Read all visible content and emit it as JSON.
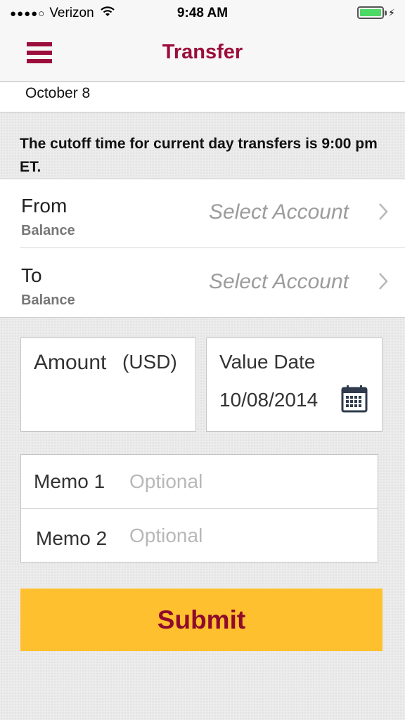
{
  "status_bar": {
    "signal_dots": "●●●●○",
    "carrier": "Verizon",
    "time": "9:48 AM",
    "battery_level": 1.0,
    "battery_color": "#4cd964"
  },
  "nav": {
    "title": "Transfer",
    "menu_icon": "hamburger-menu-icon",
    "accent_color": "#9b0e3b"
  },
  "date_header": "October 8",
  "cutoff_notice": "The cutoff time for current day transfers is 9:00 pm ET.",
  "from": {
    "label": "From",
    "sublabel": "Balance",
    "placeholder": "Select Account"
  },
  "to": {
    "label": "To",
    "sublabel": "Balance",
    "placeholder": "Select Account"
  },
  "amount": {
    "label": "Amount",
    "unit": "(USD)",
    "value": ""
  },
  "value_date": {
    "label": "Value Date",
    "value": "10/08/2014",
    "icon": "calendar-icon"
  },
  "memo1": {
    "label": "Memo 1",
    "placeholder": "Optional"
  },
  "memo2": {
    "label": "Memo 2",
    "placeholder": "Optional"
  },
  "submit_label": "Submit",
  "submit_color": "#fec02e"
}
